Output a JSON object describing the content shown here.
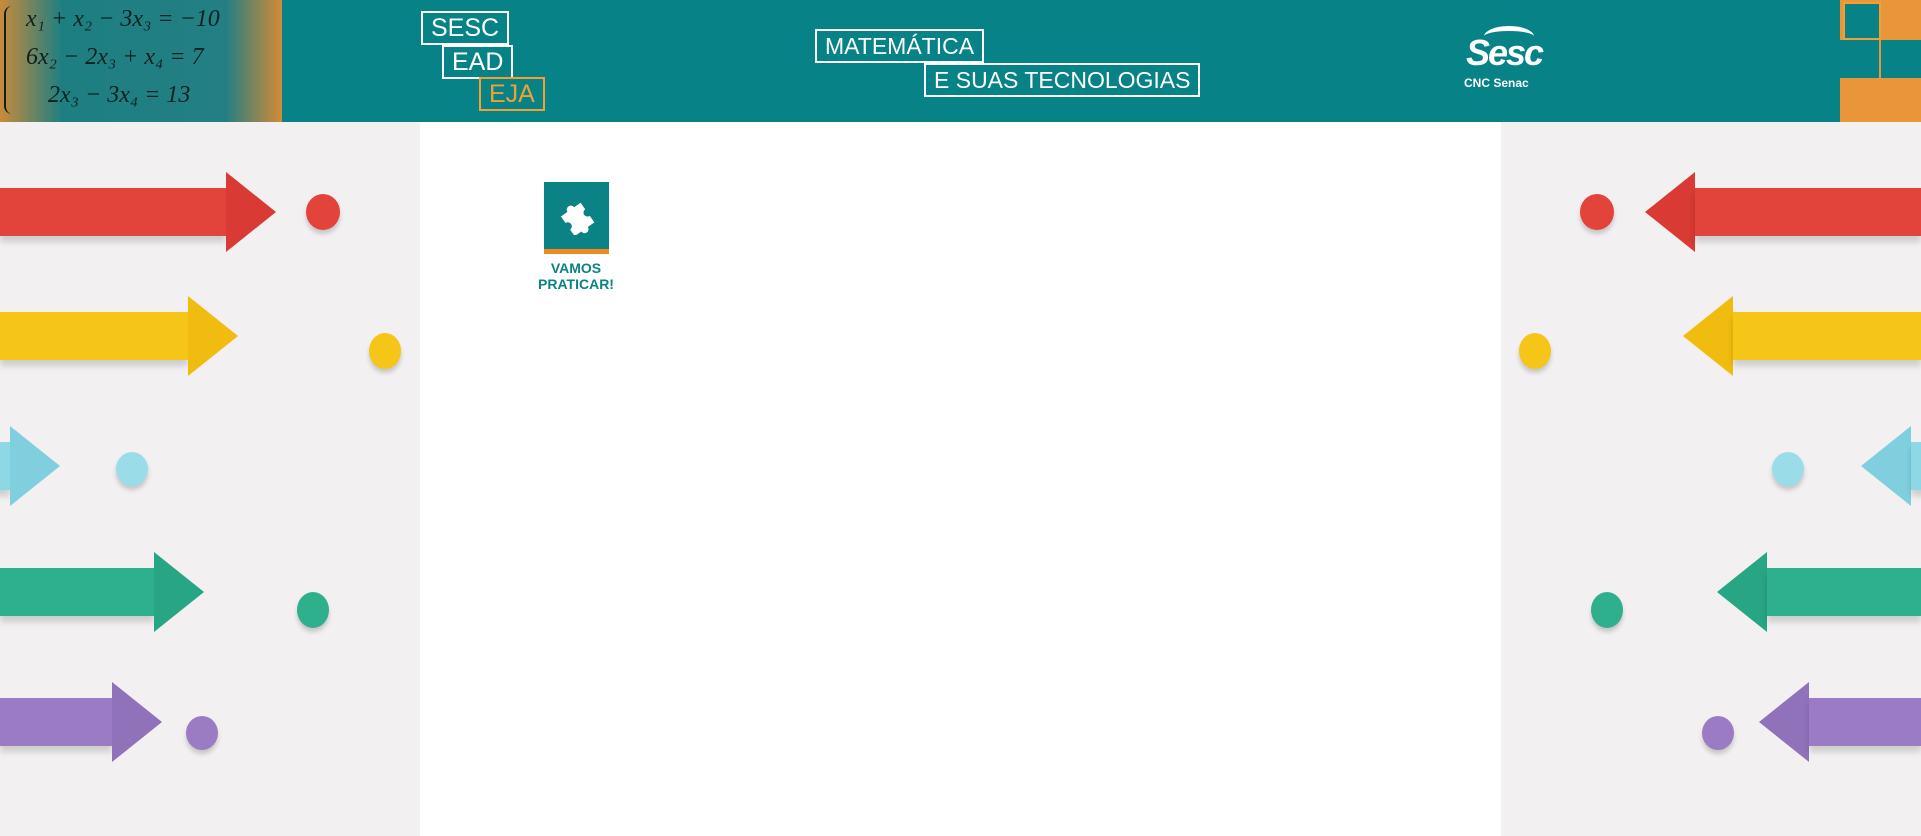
{
  "header": {
    "equations": [
      "x₁ + x₂ − 3x₃ = −10",
      "6x₂ − 2x₃ + x₄ = 7",
      "2x₃ − 3x₄ = 13"
    ],
    "brand_boxes": [
      "SESC",
      "EAD",
      "EJA"
    ],
    "subject_line1": "MATEMÁTICA",
    "subject_line2": "E SUAS TECNOLOGIAS",
    "logo_word": "Sesc",
    "logo_sub": "CNC  Senac"
  },
  "main": {
    "practice_label_line1": "VAMOS",
    "practice_label_line2": "PRATICAR!",
    "practice_icon": "puzzle-piece-icon"
  },
  "colors": {
    "header_bg": "#078286",
    "accent_orange": "#f2a033",
    "arrow_red": "#e2443c",
    "arrow_yellow": "#f5c518",
    "arrow_lightblue": "#8ed8e6",
    "arrow_green": "#2fb08c",
    "arrow_purple": "#9b7cc4"
  }
}
